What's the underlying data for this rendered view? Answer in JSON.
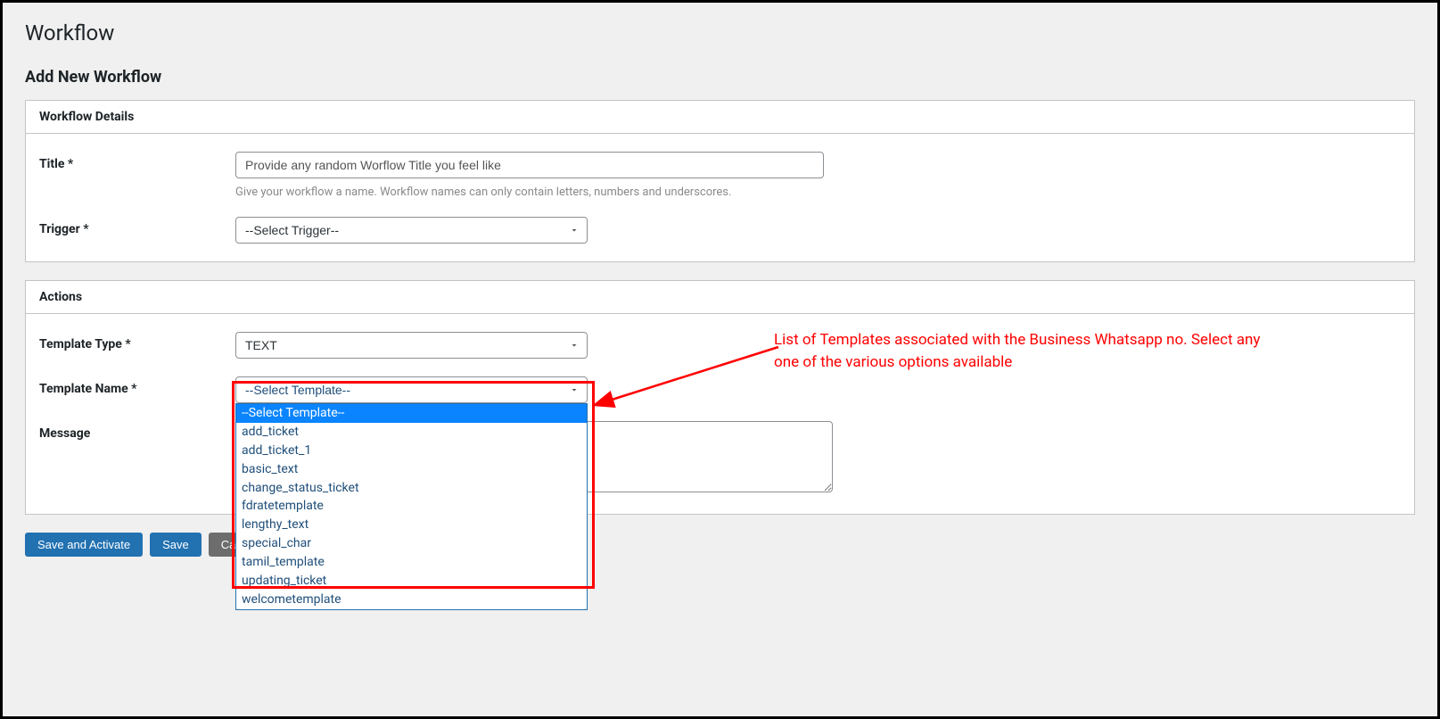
{
  "page": {
    "title": "Workflow",
    "sub_title": "Add New Workflow"
  },
  "workflow_details": {
    "panel_title": "Workflow Details",
    "title_label": "Title *",
    "title_placeholder": "Provide any random Worflow Title you feel like",
    "title_help": "Give your workflow a name. Workflow names can only contain letters, numbers and underscores.",
    "trigger_label": "Trigger *",
    "trigger_selected": "--Select Trigger--"
  },
  "actions": {
    "panel_title": "Actions",
    "template_type_label": "Template Type *",
    "template_type_selected": "TEXT",
    "template_name_label": "Template Name *",
    "template_name_selected": "--Select Template--",
    "template_options": [
      "--Select Template--",
      "add_ticket",
      "add_ticket_1",
      "basic_text",
      "change_status_ticket",
      "fdratetemplate",
      "lengthy_text",
      "special_char",
      "tamil_template",
      "updating_ticket",
      "welcometemplate"
    ],
    "message_label": "Message"
  },
  "annotation": {
    "text": "List of Templates associated with the Business Whatsapp no. Select any one of the various options available"
  },
  "buttons": {
    "save_activate": "Save and Activate",
    "save": "Save",
    "cancel": "Cancel"
  }
}
